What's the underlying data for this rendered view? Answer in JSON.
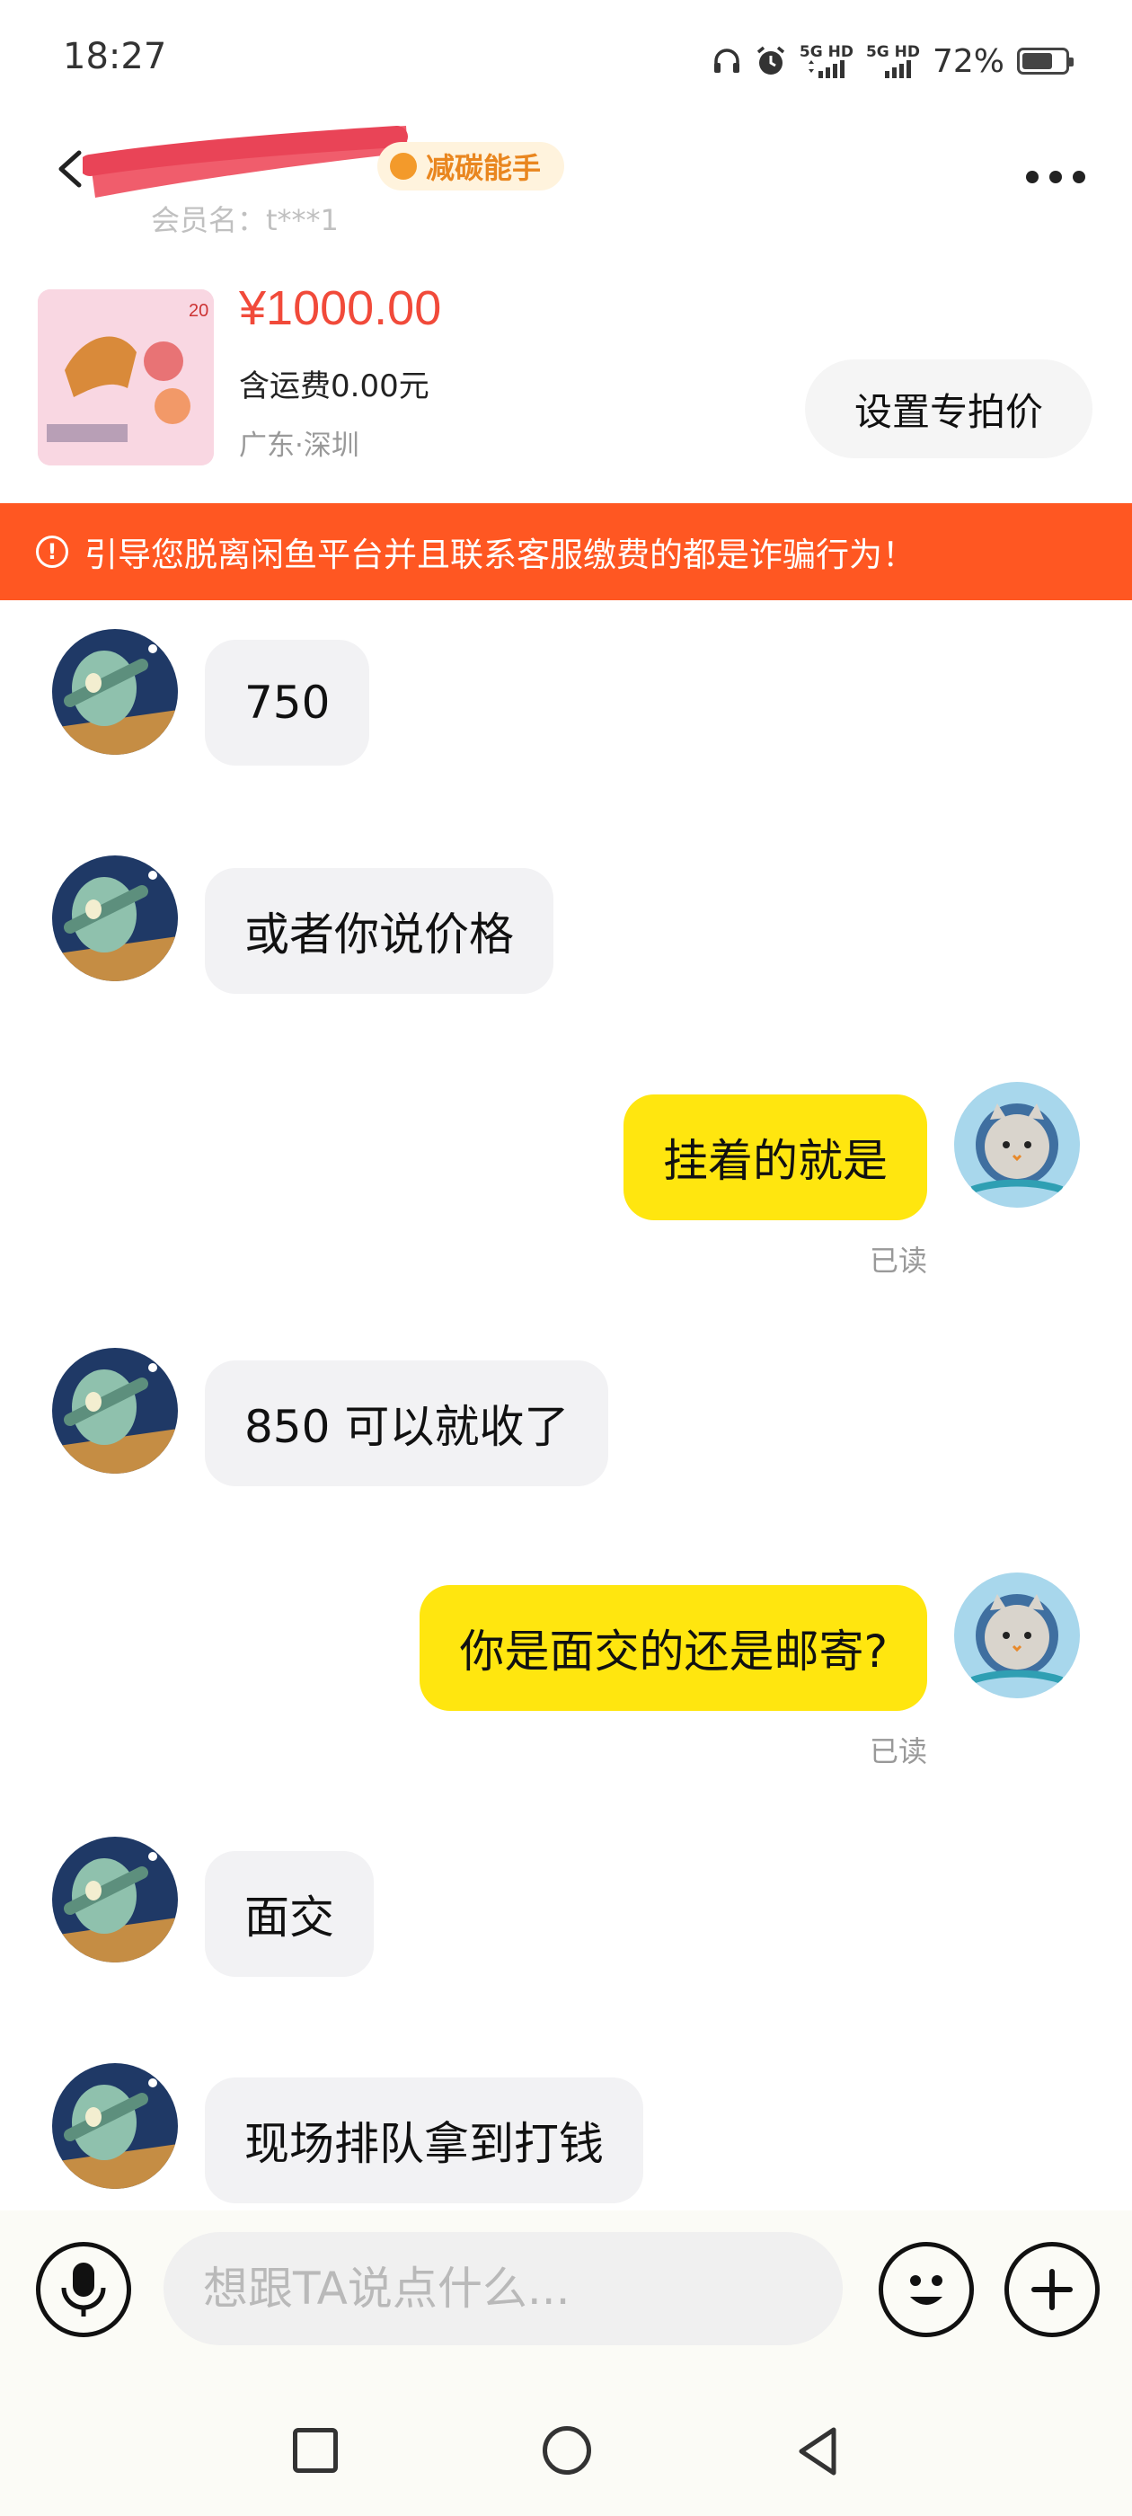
{
  "status_bar": {
    "time": "18:27",
    "signal1_top": "5G HD",
    "signal2_top": "5G HD",
    "battery_percent": "72%",
    "battery_level": 0.72
  },
  "header": {
    "badge_label": "减碳能手",
    "member_label": "会员名：t***1"
  },
  "product": {
    "price": "¥1000.00",
    "shipping": "含运费0.00元",
    "location": "广东·深圳",
    "special_price_button": "设置专拍价"
  },
  "warning": {
    "icon_glyph": "!",
    "text": "引导您脱离闲鱼平台并且联系客服缴费的都是诈骗行为！"
  },
  "messages": [
    {
      "side": "left",
      "text": "750"
    },
    {
      "side": "left",
      "text": "或者你说价格"
    },
    {
      "side": "right",
      "text": "挂着的就是",
      "status": "已读"
    },
    {
      "side": "left",
      "text": "850 可以就收了"
    },
    {
      "side": "right",
      "text": "你是面交的还是邮寄?",
      "status": "已读"
    },
    {
      "side": "left",
      "text": "面交"
    },
    {
      "side": "left",
      "text": "现场排队拿到打钱"
    }
  ],
  "composer": {
    "placeholder": "想跟TA说点什么..."
  },
  "icons": {
    "back": "chevron-left-icon",
    "more": "more-dots-icon",
    "mic": "microphone-icon",
    "emoji": "emoji-icon",
    "plus": "plus-icon",
    "nav_recent": "square-icon",
    "nav_home": "circle-icon",
    "nav_back": "triangle-back-icon"
  },
  "colors": {
    "price": "#f14a3a",
    "warning_bg": "#ff5722",
    "my_bubble": "#ffe60f",
    "their_bubble": "#f2f2f4"
  }
}
